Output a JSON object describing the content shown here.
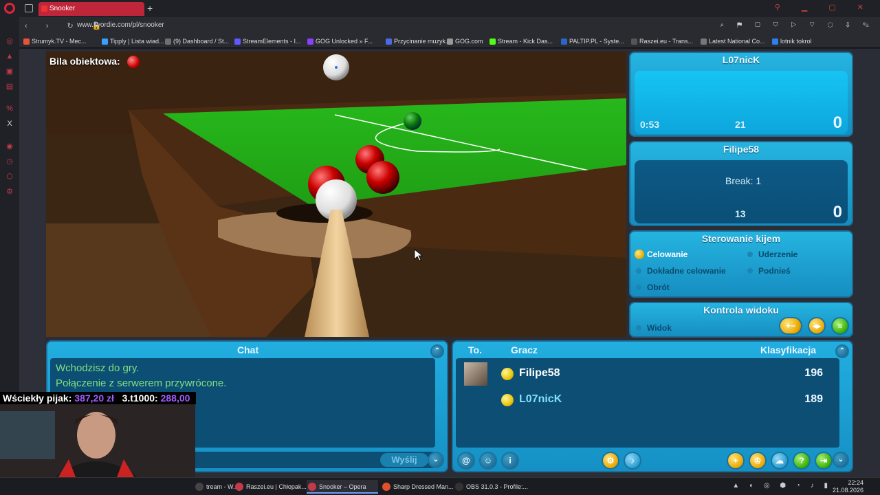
{
  "browser": {
    "active_tab": "Snooker",
    "url": "www.flyordie.com/pl/snooker",
    "bookmarks": [
      {
        "label": "Strumyk.TV - Mec...",
        "color": "#e5533b"
      },
      {
        "label": "Tipply | Lista wiad...",
        "color": "#3aa0ff"
      },
      {
        "label": "(9) Dashboard / St...",
        "color": "#6f6f6f"
      },
      {
        "label": "StreamElements - I...",
        "color": "#5b5bff"
      },
      {
        "label": "GOG Unlocked » F...",
        "color": "#8a3ffc"
      },
      {
        "label": "Przycinanie muzyk...",
        "color": "#4a6ae8"
      },
      {
        "label": "GOG.com",
        "color": "#999"
      },
      {
        "label": "Stream - Kick Das...",
        "color": "#53fc18"
      },
      {
        "label": "PALTIP.PL - Syste...",
        "color": "#2a66c9"
      },
      {
        "label": "Raszei.eu - Trans...",
        "color": "#555"
      },
      {
        "label": "Latest National Co...",
        "color": "#777"
      },
      {
        "label": "lotnik tokrol",
        "color": "#2f7ef0"
      }
    ]
  },
  "game": {
    "object_ball_label": "Bila obiektowa:",
    "player1": {
      "name": "L07nicK",
      "time": "0:53",
      "points": "21",
      "score": "0"
    },
    "player2": {
      "name": "Filipe58",
      "break": "Break: 1",
      "points": "13",
      "score": "0"
    },
    "cue_control": {
      "title": "Sterowanie kijem",
      "options": {
        "aim": "Celowanie",
        "strike": "Uderzenie",
        "fine_aim": "Dokładne celowanie",
        "raise": "Podnieś",
        "spin": "Obrót"
      }
    },
    "view_control": {
      "title": "Kontrola widoku",
      "view": "Widok"
    }
  },
  "chat": {
    "title": "Chat",
    "messages": [
      "Wchodzisz do gry.",
      "Połączenie z serwerem przywrócone."
    ],
    "send_label": "Wyślij"
  },
  "ranking": {
    "headers": {
      "to": "To.",
      "player": "Gracz",
      "rank": "Klasyfikacja"
    },
    "rows": [
      {
        "name": "Filipe58",
        "score": "196"
      },
      {
        "name": "L07nicK",
        "score": "189"
      }
    ]
  },
  "overlay": {
    "text_a": "Wściekły pijak:",
    "amount_a": "387,20 zł",
    "text_b": "3.t1000:",
    "amount_b": "288,00"
  },
  "taskbar": {
    "items": [
      "tream - W...",
      "Raszei.eu | Chłopak...",
      "Snooker – Opera",
      "Sharp Dressed Man...",
      "OBS 31.0.3 - Profile:..."
    ],
    "time": "22:24",
    "date": "21.08.2026"
  }
}
